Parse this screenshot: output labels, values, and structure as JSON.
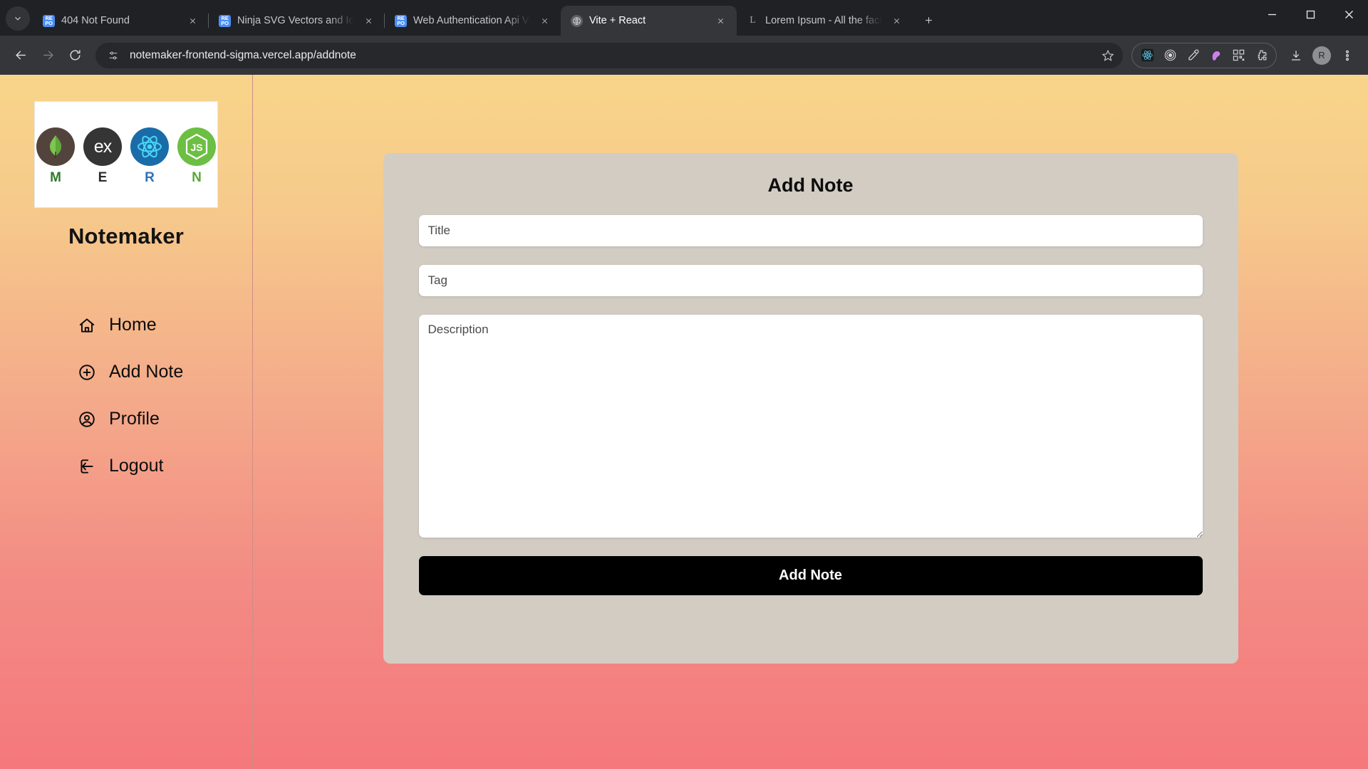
{
  "browser": {
    "tab_list_label": "Search tabs",
    "tabs": [
      {
        "title": "404 Not Found",
        "favicon": "repo-icon",
        "active": false
      },
      {
        "title": "Ninja SVG Vectors and Icons - S",
        "favicon": "repo-icon",
        "active": false
      },
      {
        "title": "Web Authentication Api Vector",
        "favicon": "repo-icon",
        "active": false
      },
      {
        "title": "Vite + React",
        "favicon": "vite-icon",
        "active": true
      },
      {
        "title": "Lorem Ipsum - All the facts - Lip",
        "favicon": "lorem-icon",
        "active": false
      }
    ],
    "new_tab_label": "New Tab",
    "window_controls": {
      "minimize": "Minimize",
      "maximize": "Maximize",
      "close": "Close"
    },
    "omnibox": {
      "url": "notemaker-frontend-sigma.vercel.app/addnote",
      "site_info_icon": "tune-icon",
      "bookmark_icon": "star-icon"
    },
    "nav": {
      "back": "Back",
      "forward": "Forward",
      "reload": "Reload"
    },
    "extensions": [
      {
        "name": "react-devtools-icon"
      },
      {
        "name": "target-rings-icon"
      },
      {
        "name": "eyedropper-icon"
      },
      {
        "name": "color-blob-icon"
      },
      {
        "name": "qr-code-icon"
      },
      {
        "name": "extensions-puzzle-icon"
      }
    ],
    "toolbar_right": [
      {
        "name": "downloads-icon"
      },
      {
        "name": "profile-avatar",
        "initial": "R"
      },
      {
        "name": "chrome-menu-icon"
      }
    ]
  },
  "sidebar": {
    "brand": "Notemaker",
    "logo": {
      "items": [
        {
          "letter": "M",
          "letter_color": "#2d7a2d",
          "circle_color": "#52443c",
          "glyph": "mongodb-leaf-icon"
        },
        {
          "letter": "E",
          "letter_color": "#2b2b2b",
          "circle_color": "#353535",
          "glyph": "express-ex-icon"
        },
        {
          "letter": "R",
          "letter_color": "#2f72b8",
          "circle_color": "#1a6ca8",
          "glyph": "react-atom-icon"
        },
        {
          "letter": "N",
          "letter_color": "#5aa832",
          "circle_color": "#6cbf43",
          "glyph": "nodejs-hex-icon"
        }
      ]
    },
    "items": [
      {
        "label": "Home",
        "icon": "home-icon"
      },
      {
        "label": "Add Note",
        "icon": "plus-circle-icon"
      },
      {
        "label": "Profile",
        "icon": "user-circle-icon"
      },
      {
        "label": "Logout",
        "icon": "logout-arrow-icon"
      }
    ]
  },
  "main": {
    "card_title": "Add Note",
    "fields": {
      "title": {
        "value": "",
        "placeholder": "Title"
      },
      "tag": {
        "value": "",
        "placeholder": "Tag"
      },
      "description": {
        "value": "",
        "placeholder": "Description"
      }
    },
    "submit_label": "Add Note"
  },
  "colors": {
    "page_gradient_top": "#f8d58a",
    "page_gradient_bottom": "#f4787c",
    "card_bg": "#d2ccc3",
    "button_bg": "#000000",
    "chrome_bg": "#202124",
    "toolbar_bg": "#35363a"
  }
}
